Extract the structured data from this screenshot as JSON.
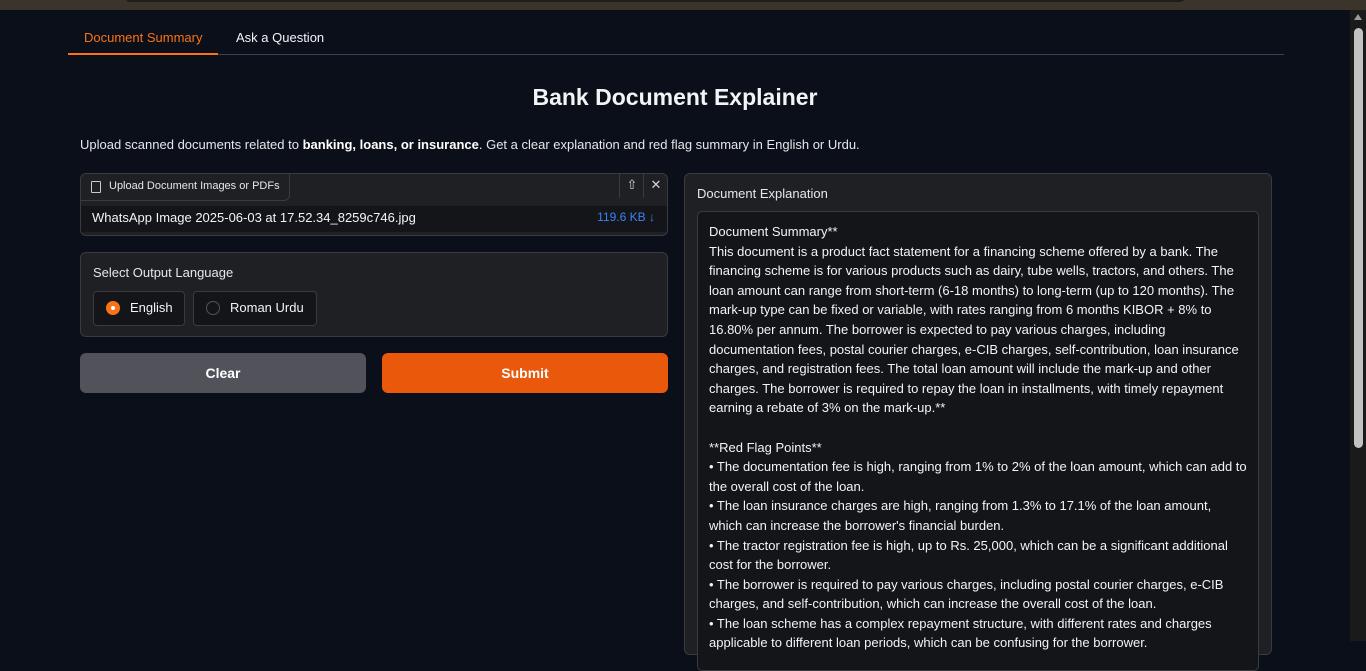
{
  "tabs": [
    {
      "label": "Document Summary",
      "active": true
    },
    {
      "label": "Ask a Question",
      "active": false
    }
  ],
  "title": "Bank Document Explainer",
  "subtitle": {
    "before": "Upload scanned documents related to ",
    "bold": "banking, loans, or insurance",
    "after": ". Get a clear explanation and red flag summary in English or Urdu."
  },
  "upload": {
    "label": "Upload Document Images or PDFs",
    "file_name": "WhatsApp Image 2025-06-03 at 17.52.34_8259c746.jpg",
    "file_size": "119.6 KB ↓"
  },
  "language": {
    "label": "Select Output Language",
    "options": [
      "English",
      "Roman Urdu"
    ],
    "selected": "English"
  },
  "buttons": {
    "clear": "Clear",
    "submit": "Submit"
  },
  "explanation": {
    "label": "Document Explanation",
    "summary_heading": "Document Summary**",
    "summary": "This document is a product fact statement for a financing scheme offered by a bank. The financing scheme is for various products such as dairy, tube wells, tractors, and others. The loan amount can range from short-term (6-18 months) to long-term (up to 120 months). The mark-up type can be fixed or variable, with rates ranging from 6 months KIBOR + 8% to 16.80% per annum. The borrower is expected to pay various charges, including documentation fees, postal courier charges, e-CIB charges, self-contribution, loan insurance charges, and registration fees. The total loan amount will include the mark-up and other charges. The borrower is required to repay the loan in installments, with timely repayment earning a rebate of 3% on the mark-up.**",
    "red_flag_heading": "**Red Flag Points**",
    "red_flags": [
      "• The documentation fee is high, ranging from 1% to 2% of the loan amount, which can add to the overall cost of the loan.",
      "• The loan insurance charges are high, ranging from 1.3% to 17.1% of the loan amount, which can increase the borrower's financial burden.",
      "• The tractor registration fee is high, up to Rs. 25,000, which can be a significant additional cost for the borrower.",
      "• The borrower is required to pay various charges, including postal courier charges, e-CIB charges, and self-contribution, which can increase the overall cost of the loan.",
      "• The loan scheme has a complex repayment structure, with different rates and charges applicable to different loan periods, which can be confusing for the borrower."
    ]
  }
}
